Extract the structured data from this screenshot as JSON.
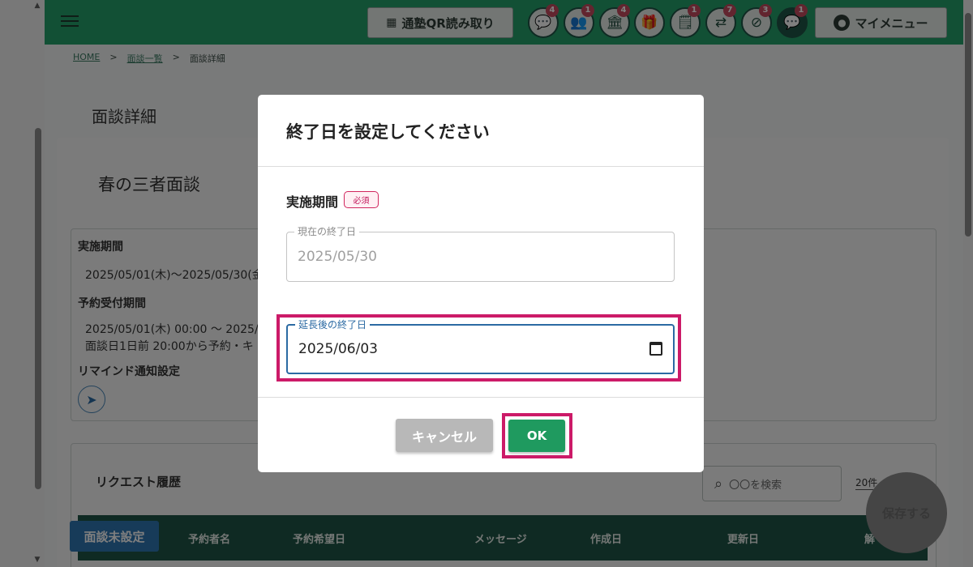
{
  "topbar": {
    "qr_label": "通塾QR読み取り",
    "mymenu_label": "マイメニュー",
    "icons": [
      {
        "name": "chat-icon",
        "glyph": "💬",
        "badge": "4"
      },
      {
        "name": "group-icon",
        "glyph": "👥",
        "badge": "1"
      },
      {
        "name": "school-icon",
        "glyph": "🏛",
        "badge": "4"
      },
      {
        "name": "gift-icon",
        "glyph": "🎁",
        "badge": ""
      },
      {
        "name": "report-icon",
        "glyph": "🗒",
        "badge": "1"
      },
      {
        "name": "transfer-icon",
        "glyph": "⇄",
        "badge": "7"
      },
      {
        "name": "location-off-icon",
        "glyph": "⊘",
        "badge": "3"
      },
      {
        "name": "message-icon",
        "glyph": "💬",
        "badge": "1"
      }
    ]
  },
  "breadcrumb": {
    "home": "HOME",
    "sep": ">",
    "list": "面談一覧",
    "current": "面談詳細"
  },
  "page": {
    "title": "面談詳細",
    "event_title": "春の三者面談"
  },
  "info": {
    "period_label": "実施期間",
    "period_value": "2025/05/01(木)〜2025/05/30(金)",
    "reservation_label": "予約受付期間",
    "reservation_value": "2025/05/01(木) 00:00 〜 2025/05/",
    "reservation_note": "面談日1日前 20:00から予約・キ",
    "remind_label": "リマインド通知設定"
  },
  "requests": {
    "title": "リクエスト履歴",
    "search_placeholder": "〇〇を検索",
    "per_page": "20件",
    "columns": [
      "予約者名",
      "予約希望日",
      "メッセージ",
      "作成日",
      "更新日",
      "解"
    ],
    "unset_button": "面談未設定",
    "save_button": "保存する"
  },
  "dialog": {
    "title": "終了日を設定してください",
    "period_label": "実施期間",
    "required_badge": "必須",
    "current_end_label": "現在の終了日",
    "current_end_value": "2025/05/30",
    "extended_end_label": "延長後の終了日",
    "extended_end_value": "2025/06/03",
    "cancel_label": "キャンセル",
    "ok_label": "OK"
  },
  "colors": {
    "topbar": "#25a06a",
    "table_header": "#1f5546",
    "ok_button": "#1f9a5f",
    "highlight": "#cc1a68",
    "focus_border": "#2b6aa3"
  }
}
